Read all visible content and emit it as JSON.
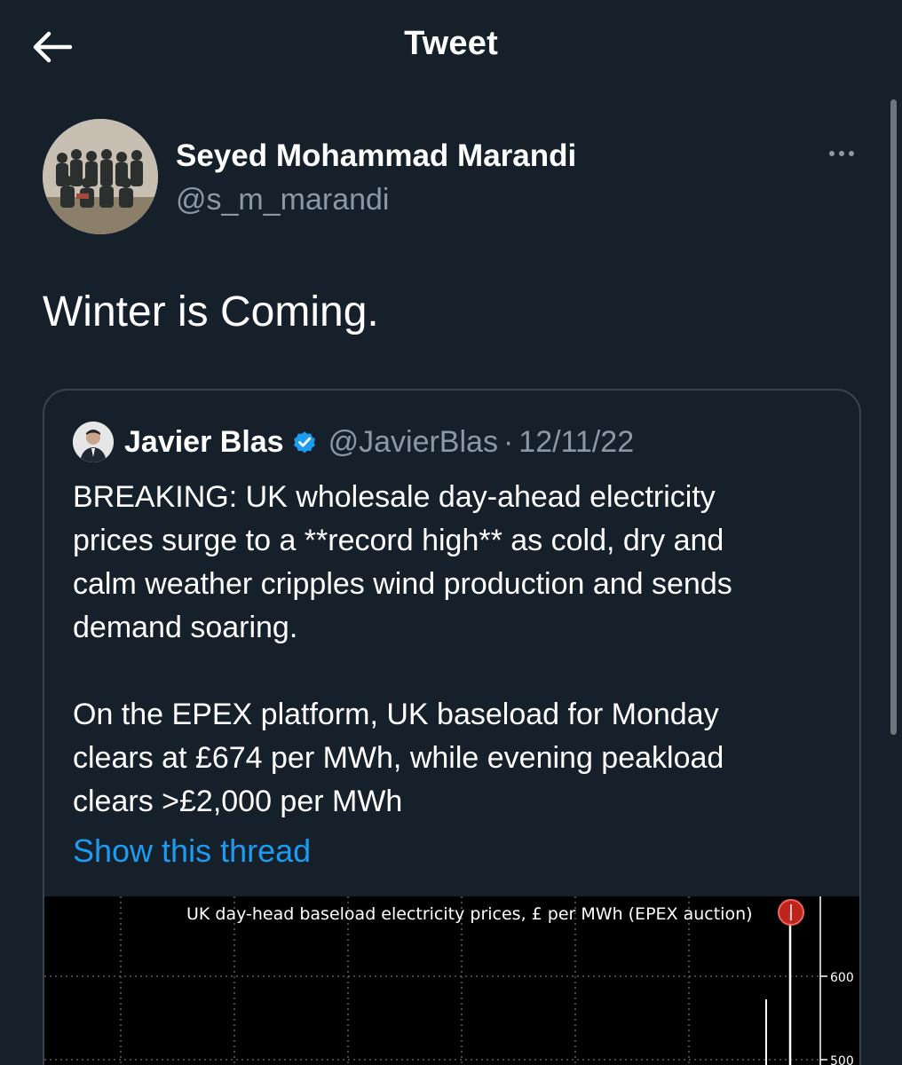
{
  "header": {
    "title": "Tweet"
  },
  "tweet": {
    "author_name": "Seyed Mohammad Marandi",
    "author_handle": "@s_m_marandi",
    "text": "Winter is Coming."
  },
  "quote": {
    "author_name": "Javier Blas",
    "author_handle": "@JavierBlas",
    "separator": "·",
    "date": "12/11/22",
    "verified": true,
    "paragraph1": [
      "BREAKING: UK wholesale day-ahead electricity",
      "prices surge to a **record high** as cold, dry and",
      "calm weather cripples wind production and sends",
      "demand soaring."
    ],
    "paragraph2": [
      "On the EPEX platform, UK baseload for Monday",
      "clears at £674 per MWh, while evening peakload",
      "clears >£2,000 per MWh"
    ],
    "show_thread": "Show this thread"
  },
  "chart_data": {
    "type": "line",
    "title": "UK day-head baseload electricity prices, £ per MWh (EPEX auction)",
    "y_ticks": [
      "600",
      "500"
    ],
    "grid": true
  },
  "colors": {
    "background": "#15202b",
    "secondary_text": "#8b98a5",
    "link": "#1d9bf0",
    "border": "#38444d",
    "chart_line": "#ffffff",
    "chart_marker": "#e0302a"
  }
}
